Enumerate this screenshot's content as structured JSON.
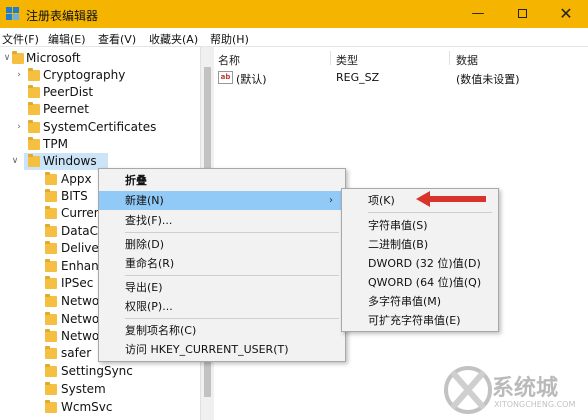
{
  "window": {
    "title": "注册表编辑器",
    "controls": {
      "minimize": "—",
      "close": "✕"
    }
  },
  "menubar": [
    "文件(F)",
    "编辑(E)",
    "查看(V)",
    "收藏夹(A)",
    "帮助(H)"
  ],
  "tree": {
    "items": [
      {
        "label": "Microsoft",
        "chev": "∨"
      },
      {
        "label": "Cryptography",
        "chev": "›"
      },
      {
        "label": "PeerDist",
        "chev": ""
      },
      {
        "label": "Peernet",
        "chev": ""
      },
      {
        "label": "SystemCertificates",
        "chev": "›"
      },
      {
        "label": "TPM",
        "chev": ""
      },
      {
        "label": "Windows",
        "chev": "∨"
      },
      {
        "label": "Appx",
        "chev": ""
      },
      {
        "label": "BITS",
        "chev": ""
      },
      {
        "label": "Curren",
        "chev": ""
      },
      {
        "label": "DataC",
        "chev": ""
      },
      {
        "label": "Delive",
        "chev": ""
      },
      {
        "label": "Enhan",
        "chev": ""
      },
      {
        "label": "IPSec",
        "chev": ""
      },
      {
        "label": "Netwo",
        "chev": ""
      },
      {
        "label": "Netwo",
        "chev": ""
      },
      {
        "label": "Netwo",
        "chev": ""
      },
      {
        "label": "safer",
        "chev": ""
      },
      {
        "label": "SettingSync",
        "chev": ""
      },
      {
        "label": "System",
        "chev": ""
      },
      {
        "label": "WcmSvc",
        "chev": ""
      }
    ]
  },
  "values_pane": {
    "columns": [
      "名称",
      "类型",
      "数据"
    ],
    "rows": [
      {
        "icon": "ab",
        "name": "(默认)",
        "type": "REG_SZ",
        "data": "(数值未设置)"
      }
    ]
  },
  "context_menu": {
    "items": [
      "折叠",
      "新建(N)",
      "查找(F)...",
      "删除(D)",
      "重命名(R)",
      "导出(E)",
      "权限(P)...",
      "复制项名称(C)",
      "访问 HKEY_CURRENT_USER(T)"
    ],
    "submenu_arrow": "›"
  },
  "submenu": {
    "items": [
      "项(K)",
      "字符串值(S)",
      "二进制值(B)",
      "DWORD (32 位)值(D)",
      "QWORD (64 位)值(Q)",
      "多字符串值(M)",
      "可扩充字符串值(E)"
    ]
  },
  "watermark": {
    "line1": "系统城",
    "line2": "XITONGCHENG.COM"
  },
  "colors": {
    "titlebar": "#f4b400",
    "highlight": "#91c9f7",
    "selected": "#cce4f7",
    "arrow": "#d9342b"
  }
}
